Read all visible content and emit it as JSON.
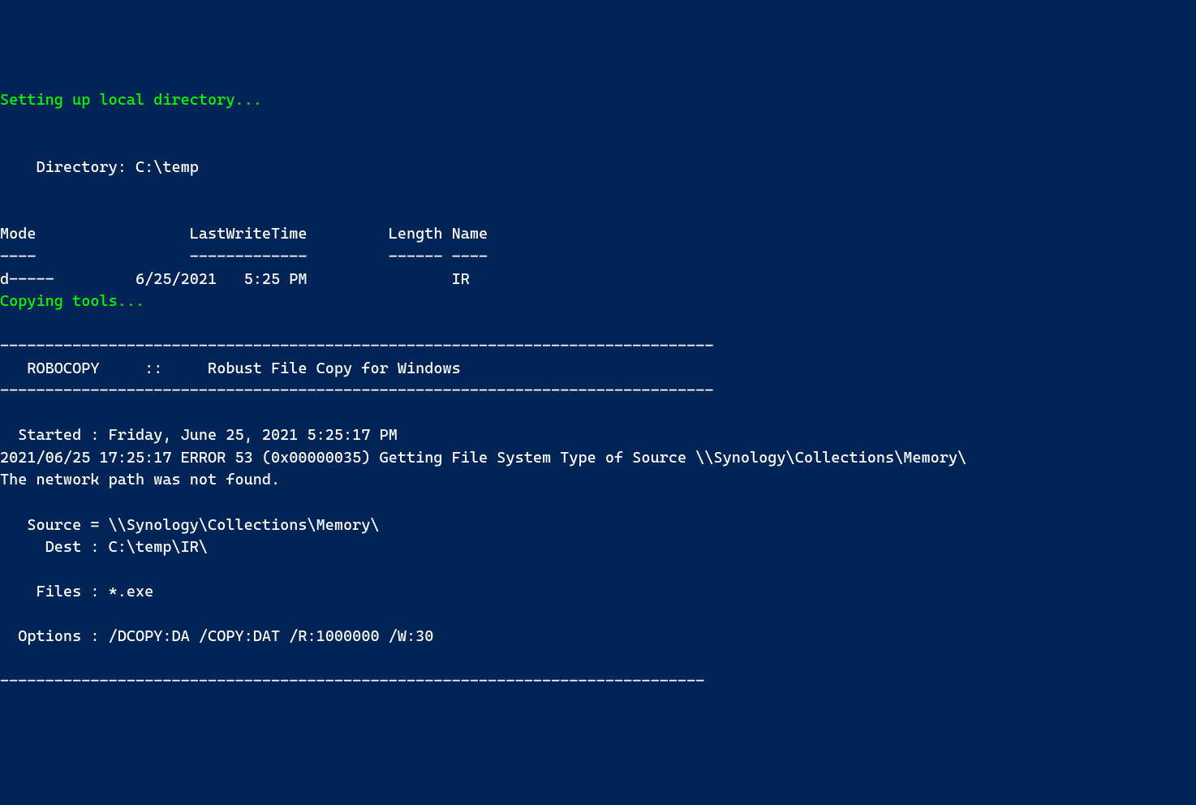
{
  "lines": {
    "l0": "Setting up local directory...",
    "l1": "",
    "l2": "",
    "l3": "    Directory: C:\\temp",
    "l4": "",
    "l5": "",
    "l6": "Mode                 LastWriteTime         Length Name",
    "l7": "----                 -------------         ------ ----",
    "l8": "d-----         6/25/2021   5:25 PM                IR",
    "l9": "Copying tools...",
    "l10": "",
    "l11": "-------------------------------------------------------------------------------",
    "l12": "   ROBOCOPY     ::     Robust File Copy for Windows",
    "l13": "-------------------------------------------------------------------------------",
    "l14": "",
    "l15": "  Started : Friday, June 25, 2021 5:25:17 PM",
    "l16": "2021/06/25 17:25:17 ERROR 53 (0x00000035) Getting File System Type of Source \\\\Synology\\Collections\\Memory\\",
    "l17": "The network path was not found.",
    "l18": "",
    "l19": "   Source = \\\\Synology\\Collections\\Memory\\",
    "l20": "     Dest : C:\\temp\\IR\\",
    "l21": "",
    "l22": "    Files : *.exe",
    "l23": "",
    "l24": "  Options : /DCOPY:DA /COPY:DAT /R:1000000 /W:30",
    "l25": "",
    "l26": "------------------------------------------------------------------------------"
  }
}
